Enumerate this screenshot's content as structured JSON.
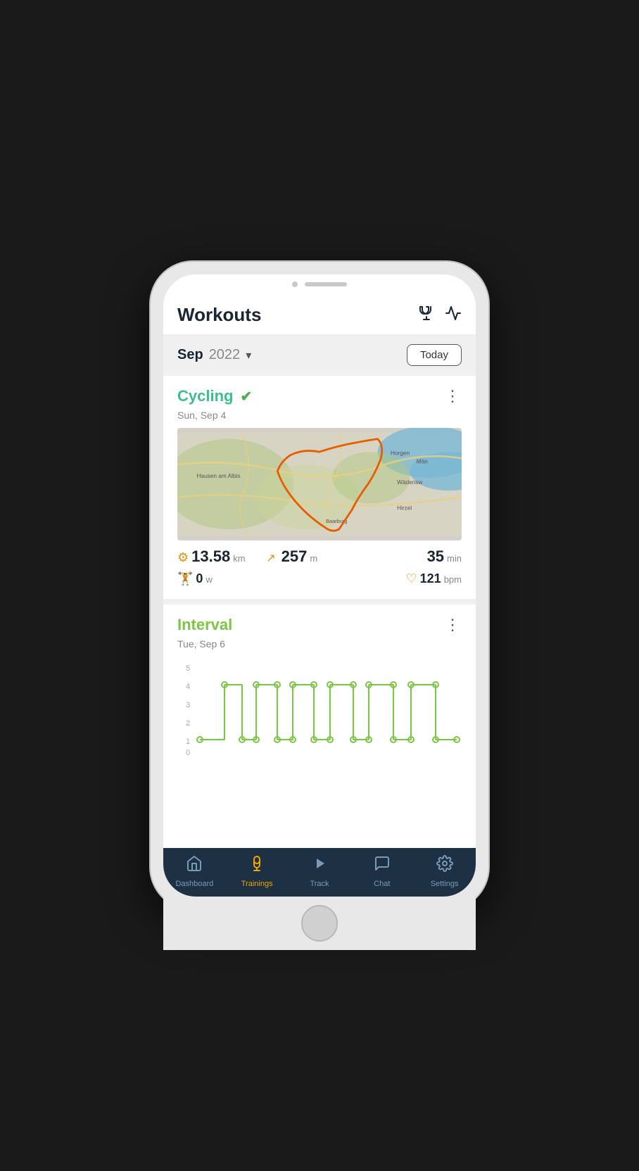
{
  "header": {
    "title": "Workouts",
    "trophy_icon": "🏆",
    "chart_icon": "📈"
  },
  "date_bar": {
    "month": "Sep",
    "year": "2022",
    "today_label": "Today"
  },
  "cycling_workout": {
    "title": "Cycling",
    "check": "✔",
    "date": "Sun, Sep 4",
    "distance_value": "13.58",
    "distance_unit": "km",
    "elevation_value": "257",
    "elevation_unit": "m",
    "duration_value": "35",
    "duration_unit": "min",
    "power_value": "0",
    "power_unit": "w",
    "heartrate_value": "121",
    "heartrate_unit": "bpm"
  },
  "interval_workout": {
    "title": "Interval",
    "date": "Tue, Sep 6",
    "chart_y_labels": [
      "5",
      "4",
      "3",
      "2",
      "1",
      "0"
    ]
  },
  "bottom_nav": {
    "items": [
      {
        "label": "Dashboard",
        "icon": "🏠",
        "active": false
      },
      {
        "label": "Trainings",
        "icon": "🍦",
        "active": true
      },
      {
        "label": "Track",
        "icon": "▶",
        "active": false
      },
      {
        "label": "Chat",
        "icon": "💬",
        "active": false
      },
      {
        "label": "Settings",
        "icon": "⚙",
        "active": false
      }
    ]
  }
}
